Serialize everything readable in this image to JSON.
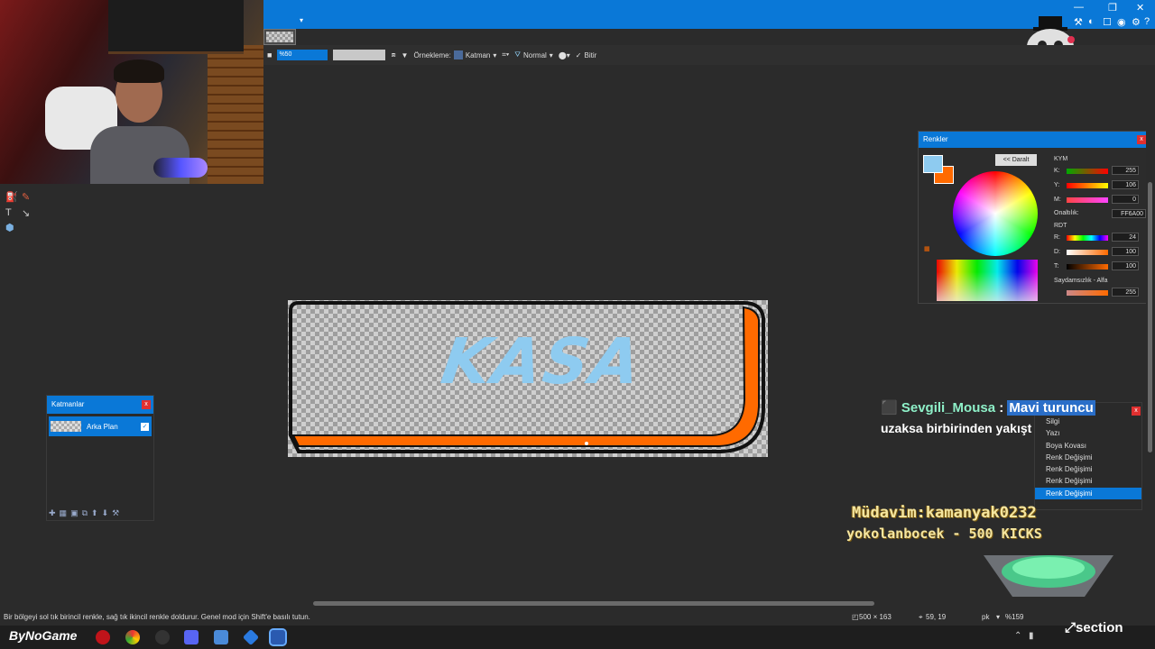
{
  "toolbar": {
    "zoom": "%50",
    "sampling_label": "Örnekleme:",
    "sampling_value": "Katman",
    "blend_mode": "Normal",
    "finish_label": "Bitir"
  },
  "layers": {
    "title": "Katmanlar",
    "items": [
      {
        "name": "Arka Plan",
        "visible": true
      }
    ]
  },
  "canvas": {
    "text": "KASA",
    "text_color": "#8ecbf0",
    "bar_color": "#ff6a00"
  },
  "colors": {
    "title": "Renkler",
    "collapse_button": "<< Daralt",
    "cmy_label": "KYM",
    "k_label": "K:",
    "k_value": "255",
    "y_label": "Y:",
    "y_value": "106",
    "m_label": "M:",
    "m_value": "0",
    "hex_label": "Onaltılık:",
    "hex_value": "FF6A00",
    "hsv_label": "RDT",
    "r_label": "R:",
    "r_value": "24",
    "d_label": "D:",
    "d_value": "100",
    "t_label": "T:",
    "t_value": "100",
    "alpha_label": "Saydamsızlık - Alfa",
    "alpha_value": "255",
    "primary": "#8ecbf0",
    "secondary": "#ff6a00"
  },
  "chat": {
    "username": "Sevgili_Mousa",
    "separator": ":",
    "highlight": "Mavi turuncu",
    "continuation": "uzaksa birbirinden yakışt"
  },
  "history": {
    "items": [
      "Silgi",
      "Silgi",
      "Yazı",
      "Boya Kovası",
      "Renk Değişimi",
      "Renk Değişimi",
      "Renk Değişimi",
      "Renk Değişimi"
    ]
  },
  "overlay": {
    "regular": "Müdavim:kamanyak0232",
    "kicks": "yokolanbocek - 500 KICKS"
  },
  "status": {
    "hint": "Bir bölgeyi sol tık birincil renkle, sağ tık ikincil renkle doldurur. Genel mod için Shift'e basılı tutun.",
    "image_size": "500 × 163",
    "cursor_pos": "59, 19",
    "unit": "pk",
    "zoom": "%159"
  },
  "taskbar": {
    "brand": "ByNoGame",
    "watermark": "section"
  }
}
